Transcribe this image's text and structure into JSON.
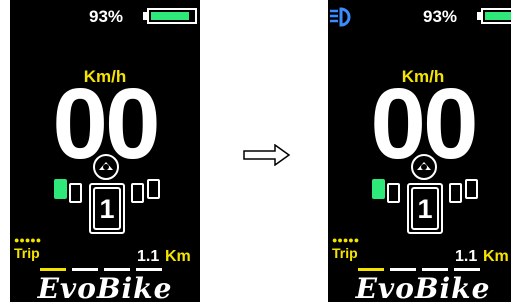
{
  "screens": [
    {
      "battery_percent": "93%",
      "battery_level": 0.9,
      "speed_unit": "Km/h",
      "speed": "00",
      "gear": "1",
      "trip_label": "Trip",
      "trip_dots": "●●●●●",
      "distance_value": "1.1",
      "distance_unit": "Km",
      "brand": "EvoBike",
      "headlight_on": false
    },
    {
      "battery_percent": "93%",
      "battery_level": 0.9,
      "speed_unit": "Km/h",
      "speed": "00",
      "gear": "1",
      "trip_label": "Trip",
      "trip_dots": "●●●●●",
      "distance_value": "1.1",
      "distance_unit": "Km",
      "brand": "EvoBike",
      "headlight_on": true
    }
  ],
  "colors": {
    "accent_yellow": "#f5e400",
    "battery_green": "#2ee87a",
    "headlight_blue": "#3b8cff",
    "screen_bg": "#000000"
  },
  "transition_icon": "right-arrow-icon"
}
